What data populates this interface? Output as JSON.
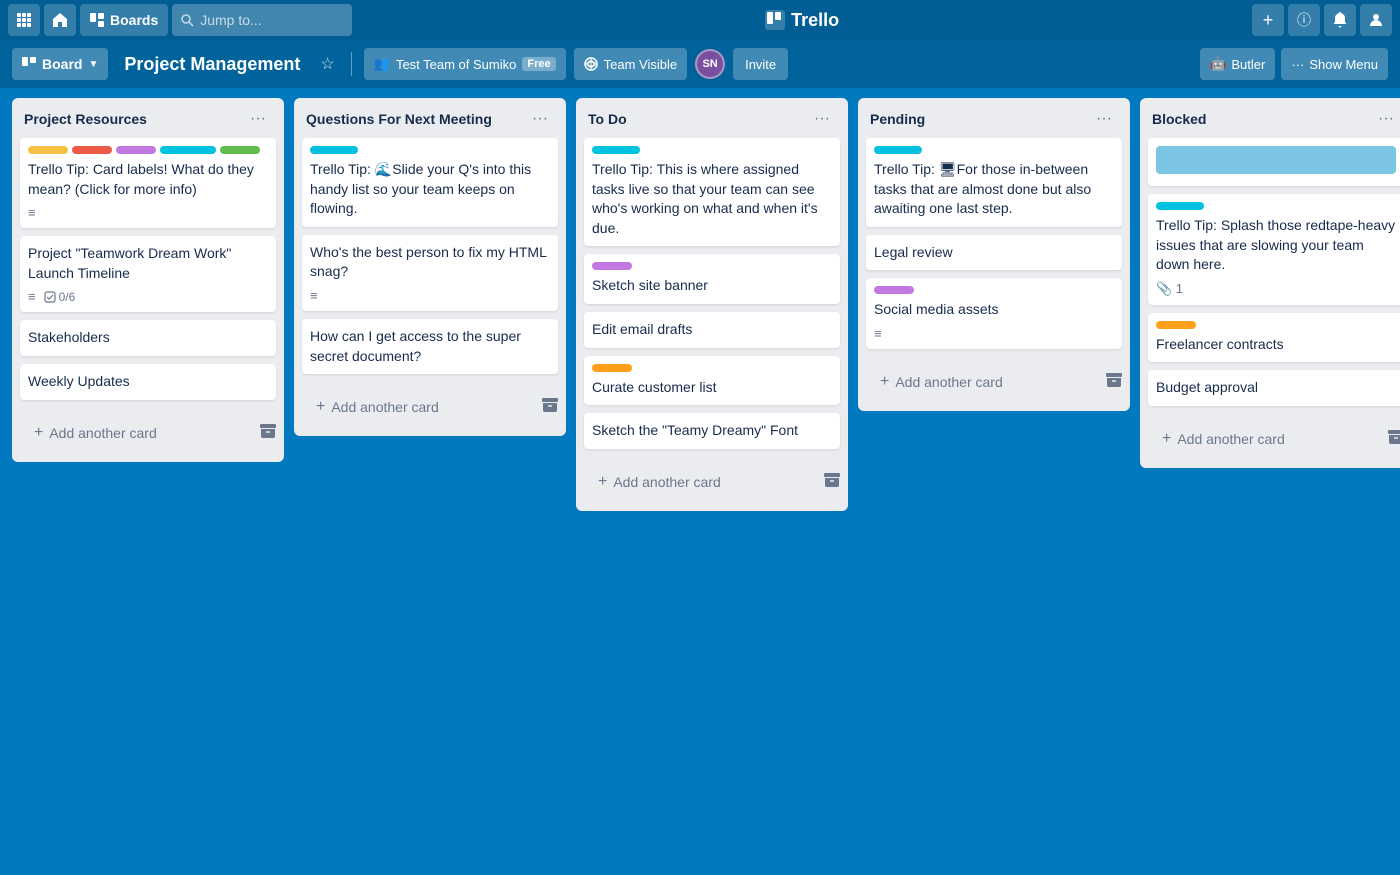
{
  "topNav": {
    "appGridLabel": "App grid",
    "homeLabel": "Home",
    "boardsLabel": "Boards",
    "searchPlaceholder": "Jump to...",
    "logoText": "Trello",
    "addLabel": "+",
    "infoLabel": "ⓘ",
    "notifyLabel": "🔔",
    "accountLabel": "Account"
  },
  "boardHeader": {
    "boardBtnLabel": "Board",
    "title": "Project Management",
    "starLabel": "★",
    "teamLabel": "Test Team of Sumiko",
    "freeBadge": "Free",
    "teamIcon": "👥",
    "teamVisibleLabel": "Team Visible",
    "avatarText": "SN",
    "inviteLabel": "Invite",
    "butlerLabel": "Butler",
    "butlerIcon": "🤖",
    "showMenuLabel": "Show Menu",
    "showMenuIcon": "···"
  },
  "lists": [
    {
      "id": "project-resources",
      "title": "Project Resources",
      "cards": [
        {
          "id": "card-1",
          "labels": [
            "yellow",
            "red",
            "purple",
            "teal",
            "green"
          ],
          "text": "Trello Tip: Card labels! What do they mean? (Click for more info)",
          "hasDescription": true,
          "hasChecklist": false,
          "hasAttachments": false
        },
        {
          "id": "card-2",
          "labels": [],
          "text": "Project \"Teamwork Dream Work\" Launch Timeline",
          "hasDescription": true,
          "hasChecklist": true,
          "checklistText": "0/6",
          "hasAttachments": false
        },
        {
          "id": "card-3",
          "labels": [],
          "text": "Stakeholders",
          "hasDescription": false,
          "hasChecklist": false
        },
        {
          "id": "card-4",
          "labels": [],
          "text": "Weekly Updates",
          "hasDescription": false,
          "hasChecklist": false
        }
      ],
      "addCardLabel": "Add another card"
    },
    {
      "id": "questions-for-next-meeting",
      "title": "Questions For Next Meeting",
      "cards": [
        {
          "id": "card-5",
          "labels": [
            "cyan"
          ],
          "text": "Trello Tip: 🌊Slide your Q's into this handy list so your team keeps on flowing.",
          "hasDescription": false
        },
        {
          "id": "card-6",
          "labels": [],
          "text": "Who's the best person to fix my HTML snag?",
          "hasDescription": true
        },
        {
          "id": "card-7",
          "labels": [],
          "text": "How can I get access to the super secret document?",
          "hasDescription": false
        }
      ],
      "addCardLabel": "Add another card"
    },
    {
      "id": "to-do",
      "title": "To Do",
      "cards": [
        {
          "id": "card-8",
          "labels": [
            "cyan"
          ],
          "text": "Trello Tip: This is where assigned tasks live so that your team can see who's working on what and when it's due.",
          "hasDescription": false
        },
        {
          "id": "card-9",
          "labels": [
            "purple"
          ],
          "text": "Sketch site banner",
          "hasDescription": false
        },
        {
          "id": "card-10",
          "labels": [],
          "text": "Edit email drafts",
          "hasDescription": false
        },
        {
          "id": "card-11",
          "labels": [
            "orange"
          ],
          "text": "Curate customer list",
          "hasDescription": false
        },
        {
          "id": "card-12",
          "labels": [],
          "text": "Sketch the \"Teamy Dreamy\" Font",
          "hasDescription": false
        }
      ],
      "addCardLabel": "Add another card"
    },
    {
      "id": "pending",
      "title": "Pending",
      "cards": [
        {
          "id": "card-13",
          "labels": [
            "cyan"
          ],
          "text": "Trello Tip: 🖥For those in-between tasks that are almost done but also awaiting one last step.",
          "hasDescription": false
        },
        {
          "id": "card-14",
          "labels": [],
          "text": "Legal review",
          "hasDescription": false
        },
        {
          "id": "card-15",
          "labels": [
            "purple"
          ],
          "text": "Social media assets",
          "hasDescription": true
        }
      ],
      "addCardLabel": "Add another card"
    },
    {
      "id": "blocked",
      "title": "Blocked",
      "cards": [
        {
          "id": "card-16",
          "labels": [
            "bluegray"
          ],
          "text": "",
          "hasDescription": false,
          "isImageCard": true
        },
        {
          "id": "card-17",
          "labels": [
            "cyan"
          ],
          "text": "Trello Tip: Splash those redtape-heavy issues that are slowing your team down here.",
          "hasDescription": false,
          "hasAttachments": true,
          "attachmentCount": "1"
        },
        {
          "id": "card-18",
          "labels": [
            "orange"
          ],
          "text": "Freelancer contracts",
          "hasDescription": false
        },
        {
          "id": "card-19",
          "labels": [],
          "text": "Budget approval",
          "hasDescription": false
        }
      ],
      "addCardLabel": "Add another card"
    }
  ]
}
